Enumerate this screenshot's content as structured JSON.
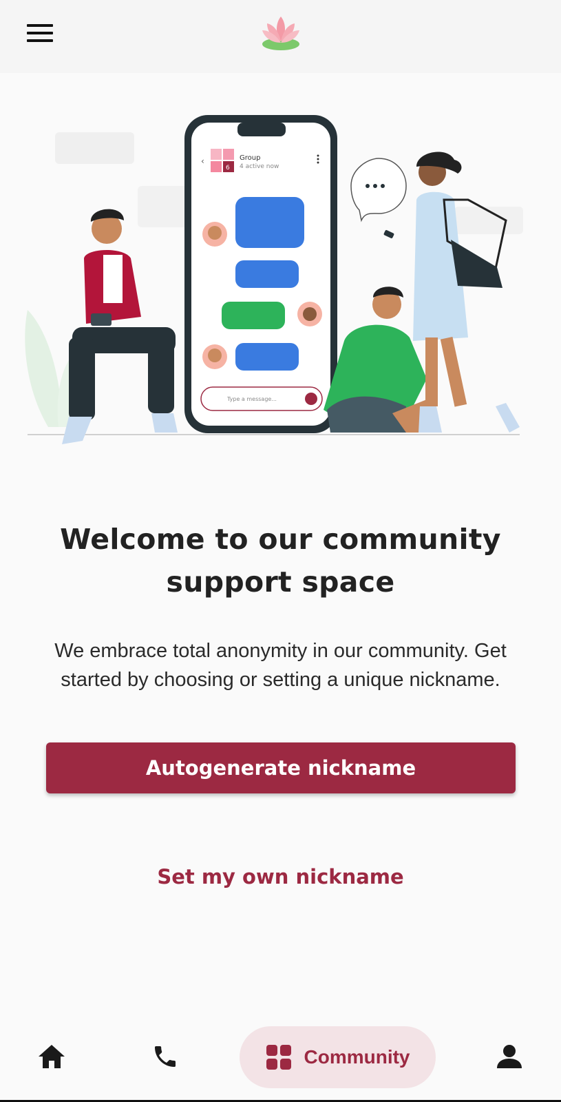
{
  "app_bar": {
    "menu_icon": "hamburger-menu-icon",
    "logo_icon": "lotus-logo-icon"
  },
  "illustration": {
    "chat_header": {
      "title": "Group",
      "status": "4 active now",
      "badge": "6"
    },
    "message_placeholder": "Type a message..."
  },
  "welcome": {
    "title_line1": "Welcome to our community",
    "title_line2": "support space",
    "description_line1": "We embrace total anonymity in our community. Get",
    "description_line2": "started by choosing or setting a unique nickname."
  },
  "actions": {
    "autogenerate_label": "Autogenerate nickname",
    "set_own_label": "Set my own nickname"
  },
  "bottom_nav": {
    "items": [
      {
        "icon": "home-icon",
        "label": ""
      },
      {
        "icon": "phone-icon",
        "label": ""
      },
      {
        "icon": "grid-icon",
        "label": "Community",
        "active": true
      },
      {
        "icon": "person-icon",
        "label": ""
      }
    ]
  },
  "colors": {
    "accent": "#9c2942",
    "active_pill": "#f3e3e6",
    "chat_blue": "#3a7be0",
    "chat_green": "#2db35a"
  }
}
